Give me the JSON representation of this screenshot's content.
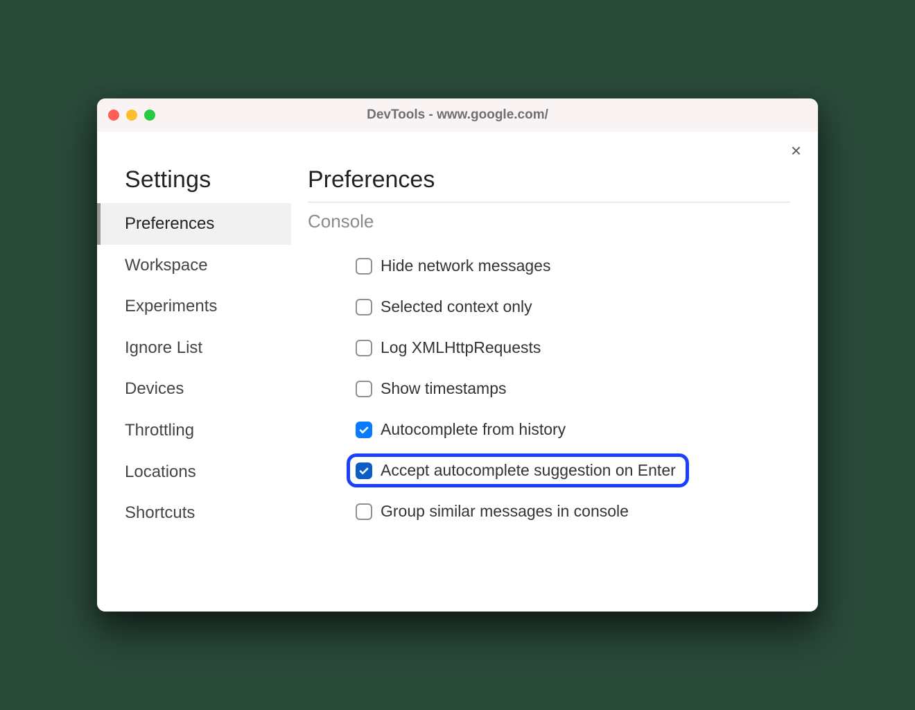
{
  "window": {
    "title": "DevTools - www.google.com/"
  },
  "settings": {
    "title": "Settings",
    "items": [
      {
        "label": "Preferences",
        "active": true
      },
      {
        "label": "Workspace",
        "active": false
      },
      {
        "label": "Experiments",
        "active": false
      },
      {
        "label": "Ignore List",
        "active": false
      },
      {
        "label": "Devices",
        "active": false
      },
      {
        "label": "Throttling",
        "active": false
      },
      {
        "label": "Locations",
        "active": false
      },
      {
        "label": "Shortcuts",
        "active": false
      }
    ]
  },
  "main": {
    "title": "Preferences",
    "section": "Console",
    "options": [
      {
        "label": "Hide network messages",
        "checked": false,
        "highlight": false
      },
      {
        "label": "Selected context only",
        "checked": false,
        "highlight": false
      },
      {
        "label": "Log XMLHttpRequests",
        "checked": false,
        "highlight": false
      },
      {
        "label": "Show timestamps",
        "checked": false,
        "highlight": false
      },
      {
        "label": "Autocomplete from history",
        "checked": true,
        "highlight": false
      },
      {
        "label": "Accept autocomplete suggestion on Enter",
        "checked": true,
        "highlight": true
      },
      {
        "label": "Group similar messages in console",
        "checked": false,
        "highlight": false
      }
    ]
  }
}
